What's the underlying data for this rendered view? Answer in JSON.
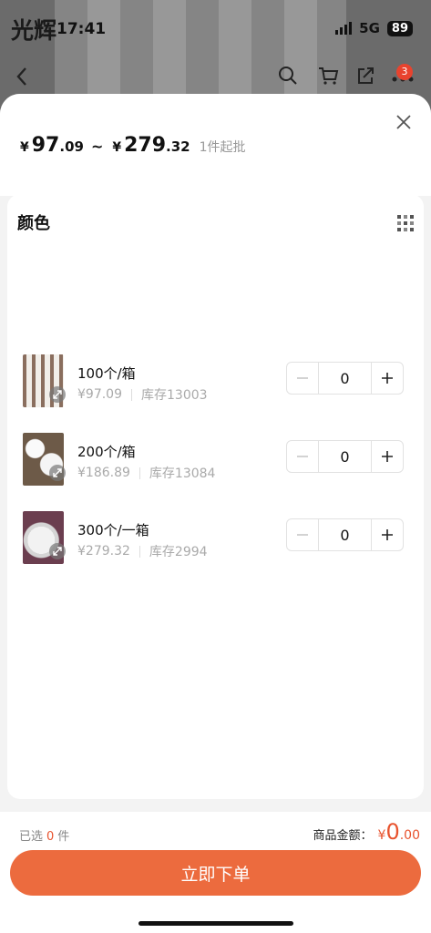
{
  "status_bar": {
    "carrier": "光辉",
    "time": "17:41",
    "network": "5G",
    "battery": "89"
  },
  "background": {
    "cart_badge_count": "3"
  },
  "price_range": {
    "low_yen": "¥",
    "low_int": "97",
    "low_dec": ".09",
    "tilde": "~",
    "high_yen": "¥",
    "high_int": "279",
    "high_dec": ".32",
    "moq": "1件起批"
  },
  "section_title": "颜色",
  "skus": [
    {
      "name": "100个/箱",
      "price": "¥97.09",
      "stock": "库存13003",
      "qty": "0"
    },
    {
      "name": "200个/箱",
      "price": "¥186.89",
      "stock": "库存13084",
      "qty": "0"
    },
    {
      "name": "300个/一箱",
      "price": "¥279.32",
      "stock": "库存2994",
      "qty": "0"
    }
  ],
  "footer": {
    "selected_prefix": "已选",
    "selected_count": "0",
    "selected_unit": "件",
    "total_label": "商品金额：",
    "total_yen": "¥",
    "total_int": "0",
    "total_dec": ".00",
    "buy_label": "立即下单"
  },
  "colors": {
    "accent": "#ec6b3e",
    "price_red": "#e8532e"
  },
  "icons": [
    "back-icon",
    "search-icon",
    "cart-icon",
    "share-icon",
    "more-icon",
    "close-icon",
    "grid-icon",
    "expand-icon",
    "minus-icon",
    "plus-icon"
  ]
}
